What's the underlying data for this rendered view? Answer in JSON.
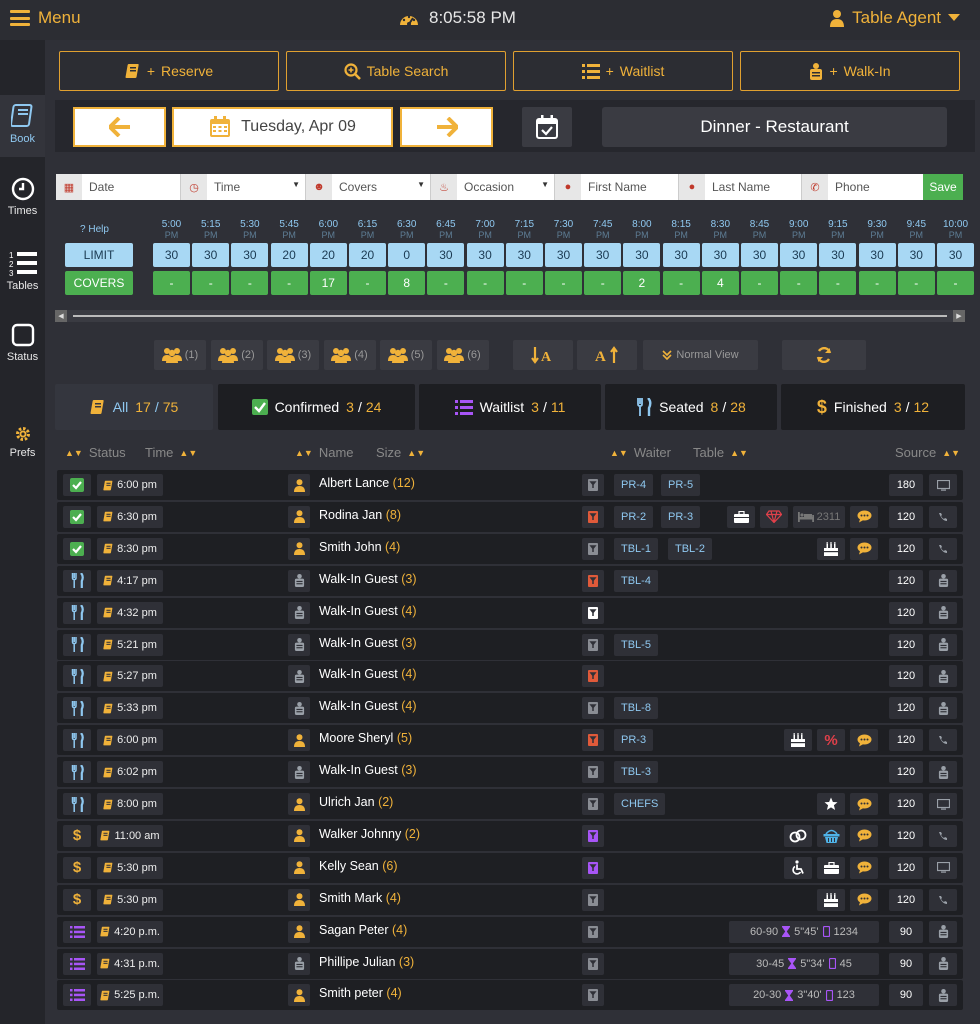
{
  "topbar": {
    "menu_label": "Menu",
    "clock": "8:05:58 PM",
    "agent_label": "Table Agent"
  },
  "sidebar": {
    "items": [
      {
        "label": "Book",
        "icon": "book-icon",
        "active": true
      },
      {
        "label": "Times",
        "icon": "clock-icon"
      },
      {
        "label": "Tables",
        "icon": "numbered-list-icon"
      },
      {
        "label": "Status",
        "icon": "square-icon"
      },
      {
        "label": "Prefs",
        "icon": "gear-icon"
      }
    ]
  },
  "actions": {
    "reserve": "Reserve",
    "table_search": "Table Search",
    "waitlist": "Waitlist",
    "walkin": "Walk-In"
  },
  "datebar": {
    "date": "Tuesday, Apr 09",
    "shift": "Dinner - Restaurant"
  },
  "form": {
    "date_ph": "Date",
    "time_ph": "Time",
    "covers_ph": "Covers",
    "occasion_ph": "Occasion",
    "first_ph": "First Name",
    "last_ph": "Last Name",
    "phone_ph": "Phone",
    "save": "Save"
  },
  "times": {
    "help": "Help",
    "limit_label": "LIMIT",
    "covers_label": "COVERS",
    "slots": [
      {
        "t": "5:00",
        "p": "PM",
        "limit": "30",
        "covers": "-"
      },
      {
        "t": "5:15",
        "p": "PM",
        "limit": "30",
        "covers": "-"
      },
      {
        "t": "5:30",
        "p": "PM",
        "limit": "30",
        "covers": "-"
      },
      {
        "t": "5:45",
        "p": "PM",
        "limit": "20",
        "covers": "-"
      },
      {
        "t": "6:00",
        "p": "PM",
        "limit": "20",
        "covers": "17"
      },
      {
        "t": "6:15",
        "p": "PM",
        "limit": "20",
        "covers": "-"
      },
      {
        "t": "6:30",
        "p": "PM",
        "limit": "0",
        "covers": "8"
      },
      {
        "t": "6:45",
        "p": "PM",
        "limit": "30",
        "covers": "-"
      },
      {
        "t": "7:00",
        "p": "PM",
        "limit": "30",
        "covers": "-"
      },
      {
        "t": "7:15",
        "p": "PM",
        "limit": "30",
        "covers": "-"
      },
      {
        "t": "7:30",
        "p": "PM",
        "limit": "30",
        "covers": "-"
      },
      {
        "t": "7:45",
        "p": "PM",
        "limit": "30",
        "covers": "-"
      },
      {
        "t": "8:00",
        "p": "PM",
        "limit": "30",
        "covers": "2"
      },
      {
        "t": "8:15",
        "p": "PM",
        "limit": "30",
        "covers": "-"
      },
      {
        "t": "8:30",
        "p": "PM",
        "limit": "30",
        "covers": "4"
      },
      {
        "t": "8:45",
        "p": "PM",
        "limit": "30",
        "covers": "-"
      },
      {
        "t": "9:00",
        "p": "PM",
        "limit": "30",
        "covers": "-"
      },
      {
        "t": "9:15",
        "p": "PM",
        "limit": "30",
        "covers": "-"
      },
      {
        "t": "9:30",
        "p": "PM",
        "limit": "30",
        "covers": "-"
      },
      {
        "t": "9:45",
        "p": "PM",
        "limit": "30",
        "covers": "-"
      },
      {
        "t": "10:00",
        "p": "PM",
        "limit": "30",
        "covers": "-"
      }
    ]
  },
  "party_filters": [
    "(1)",
    "(2)",
    "(3)",
    "(4)",
    "(5)",
    "(6)"
  ],
  "tools": {
    "normal_view": "Normal View"
  },
  "tabs": [
    {
      "label": "All",
      "a": "17",
      "b": "75",
      "icon": "book-icon"
    },
    {
      "label": "Confirmed",
      "a": "3",
      "b": "24",
      "icon": "check-icon"
    },
    {
      "label": "Waitlist",
      "a": "3",
      "b": "11",
      "icon": "list-icon"
    },
    {
      "label": "Seated",
      "a": "8",
      "b": "28",
      "icon": "fork-knife-icon"
    },
    {
      "label": "Finished",
      "a": "3",
      "b": "12",
      "icon": "dollar-icon"
    }
  ],
  "table_header": {
    "status": "Status",
    "time": "Time",
    "name": "Name",
    "size": "Size",
    "waiter": "Waiter",
    "table": "Table",
    "source": "Source"
  },
  "colors": {
    "accent": "#f0b23a",
    "blue": "#8fc8f0",
    "green": "#4caf50",
    "purple": "#a855f7",
    "red": "#e05a3a"
  },
  "rows": [
    {
      "status": "confirmed",
      "time": "6:00 pm",
      "guest": "person",
      "name": "Albert Lance",
      "size": "(12)",
      "waiter": "gray",
      "tables": [
        "PR-4",
        "PR-5"
      ],
      "extras": [],
      "wl": null,
      "source": "180",
      "src_icon": "monitor"
    },
    {
      "status": "confirmed",
      "time": "6:30 pm",
      "guest": "person",
      "name": "Rodina Jan",
      "size": "(8)",
      "waiter": "red",
      "tables": [
        "PR-2",
        "PR-3"
      ],
      "extras": [
        "briefcase",
        "gem",
        "bed",
        "chat"
      ],
      "bed_text": "2311",
      "wl": null,
      "source": "120",
      "src_icon": "phone"
    },
    {
      "status": "confirmed",
      "time": "8:30 pm",
      "guest": "person",
      "name": "Smith John",
      "size": "(4)",
      "waiter": "gray",
      "tables": [
        "TBL-1",
        "TBL-2"
      ],
      "extras": [
        "cake",
        "chat"
      ],
      "wl": null,
      "source": "120",
      "src_icon": "phone"
    },
    {
      "status": "seated",
      "time": "4:17 pm",
      "guest": "walkin",
      "name": "Walk-In Guest",
      "size": "(3)",
      "waiter": "red",
      "tables": [
        "TBL-4"
      ],
      "extras": [],
      "wl": null,
      "source": "120",
      "src_icon": "walkin"
    },
    {
      "status": "seated",
      "time": "4:32 pm",
      "guest": "walkin",
      "name": "Walk-In Guest",
      "size": "(4)",
      "waiter": "white",
      "tables": [],
      "extras": [],
      "wl": null,
      "source": "120",
      "src_icon": "walkin"
    },
    {
      "status": "seated",
      "time": "5:21 pm",
      "guest": "walkin",
      "name": "Walk-In Guest",
      "size": "(3)",
      "waiter": "gray",
      "tables": [
        "TBL-5"
      ],
      "extras": [],
      "wl": null,
      "source": "120",
      "src_icon": "walkin"
    },
    {
      "status": "seated",
      "time": "5:27 pm",
      "guest": "walkin",
      "name": "Walk-In Guest",
      "size": "(4)",
      "waiter": "red",
      "tables": [],
      "extras": [],
      "wl": null,
      "source": "120",
      "src_icon": "walkin"
    },
    {
      "status": "seated",
      "time": "5:33 pm",
      "guest": "walkin",
      "name": "Walk-In Guest",
      "size": "(4)",
      "waiter": "gray",
      "tables": [
        "TBL-8"
      ],
      "extras": [],
      "wl": null,
      "source": "120",
      "src_icon": "walkin"
    },
    {
      "status": "seated",
      "time": "6:00 pm",
      "guest": "person",
      "name": "Moore Sheryl",
      "size": "(5)",
      "waiter": "red",
      "tables": [
        "PR-3"
      ],
      "extras": [
        "cake",
        "percent",
        "chat"
      ],
      "wl": null,
      "source": "120",
      "src_icon": "phone"
    },
    {
      "status": "seated",
      "time": "6:02 pm",
      "guest": "walkin",
      "name": "Walk-In Guest",
      "size": "(3)",
      "waiter": "gray",
      "tables": [
        "TBL-3"
      ],
      "extras": [],
      "wl": null,
      "source": "120",
      "src_icon": "walkin"
    },
    {
      "status": "seated",
      "time": "8:00 pm",
      "guest": "person",
      "name": "Ulrich Jan",
      "size": "(2)",
      "waiter": "gray",
      "tables": [
        "CHEFS"
      ],
      "extras": [
        "star",
        "chat"
      ],
      "wl": null,
      "source": "120",
      "src_icon": "monitor"
    },
    {
      "status": "finished",
      "time": "11:00 am",
      "guest": "person",
      "name": "Walker Johnny",
      "size": "(2)",
      "waiter": "purple",
      "tables": [],
      "extras": [
        "rings",
        "basket",
        "chat"
      ],
      "wl": null,
      "source": "120",
      "src_icon": "phone"
    },
    {
      "status": "finished",
      "time": "5:30 pm",
      "guest": "person",
      "name": "Kelly Sean",
      "size": "(6)",
      "waiter": "purple",
      "tables": [],
      "extras": [
        "wheelchair",
        "briefcase",
        "chat"
      ],
      "wl": null,
      "source": "120",
      "src_icon": "monitor"
    },
    {
      "status": "finished",
      "time": "5:30 pm",
      "guest": "person",
      "name": "Smith Mark",
      "size": "(4)",
      "waiter": "gray",
      "tables": [],
      "extras": [
        "cake",
        "chat"
      ],
      "wl": null,
      "source": "120",
      "src_icon": "phone"
    },
    {
      "status": "waitlist",
      "time": "4:20 p.m.",
      "guest": "person",
      "name": "Sagan Peter",
      "size": "(4)",
      "waiter": "gray",
      "tables": [],
      "extras": [],
      "wl": {
        "range": "60-90",
        "wait": "5\"45'",
        "phone": "1234"
      },
      "source": "90",
      "src_icon": "walkin"
    },
    {
      "status": "waitlist",
      "time": "4:31 p.m.",
      "guest": "walkin",
      "name": "Phillipe Julian",
      "size": "(3)",
      "waiter": "gray",
      "tables": [],
      "extras": [],
      "wl": {
        "range": "30-45",
        "wait": "5\"34'",
        "phone": "45"
      },
      "source": "90",
      "src_icon": "walkin"
    },
    {
      "status": "waitlist",
      "time": "5:25 p.m.",
      "guest": "person",
      "name": "Smith peter",
      "size": "(4)",
      "waiter": "gray",
      "tables": [],
      "extras": [],
      "wl": {
        "range": "20-30",
        "wait": "3\"40'",
        "phone": "123"
      },
      "source": "90",
      "src_icon": "walkin"
    }
  ]
}
